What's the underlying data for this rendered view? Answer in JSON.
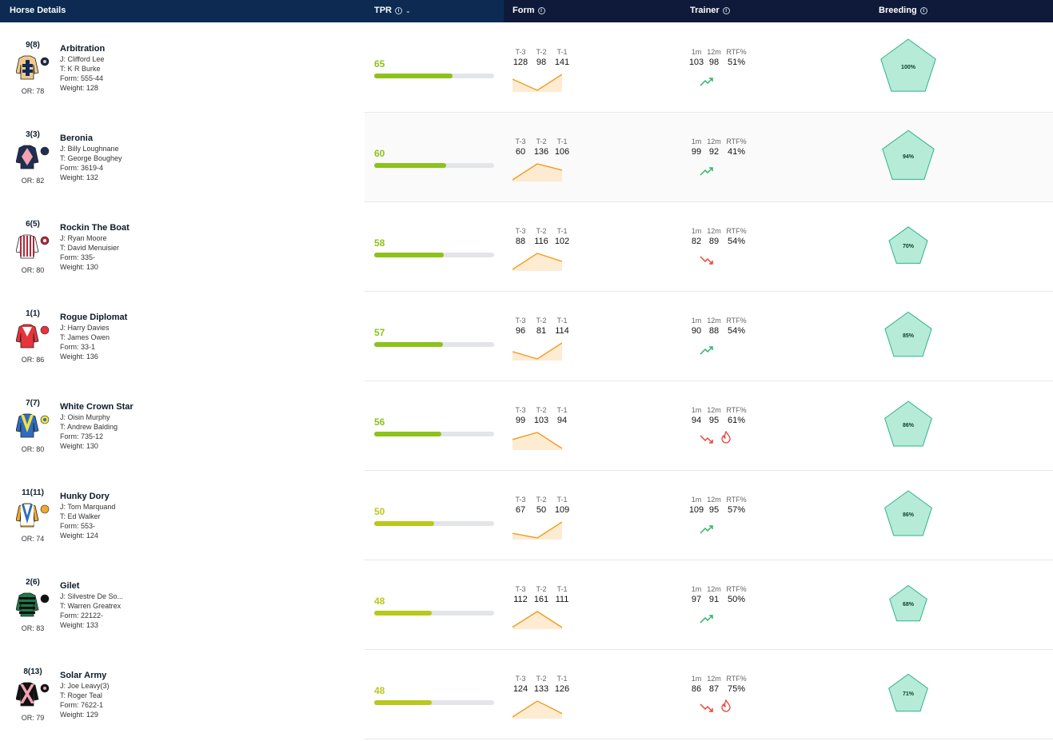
{
  "header": {
    "horse_details": "Horse Details",
    "tpr": "TPR",
    "form": "Form",
    "trainer": "Trainer",
    "breeding": "Breeding",
    "info_icon": "info-icon",
    "sort_icon": "chevron-down-icon"
  },
  "labels": {
    "form_cols": [
      "T-3",
      "T-2",
      "T-1"
    ],
    "trainer_cols": [
      "1m",
      "12m",
      "RTF%"
    ]
  },
  "colors": {
    "header_left": "#0c2a52",
    "header_right": "#0f1a3a",
    "tpr_high": "#8cc21a",
    "tpr_mid": "#b8c81c",
    "form_line": "#f39c1e",
    "trend_up": "#2fb36b",
    "trend_down": "#e8443a",
    "breeding_fill": "#b5ebd7",
    "breeding_stroke": "#2fb38a"
  },
  "horses": [
    {
      "position": "9(8)",
      "name": "Arbitration",
      "jockey": "J: Clifford Lee",
      "trainer": "T: K R Burke",
      "form": "Form: 555-44",
      "weight": "Weight: 128",
      "or": "OR: 78",
      "tpr": "65",
      "form_values": [
        "128",
        "98",
        "141"
      ],
      "trainer_stats": [
        "103",
        "98",
        "51%"
      ],
      "trend": "up",
      "hot": false,
      "breeding": "100%",
      "silk": {
        "body": "#f2c98a",
        "accent": "#102a5c",
        "pattern": "cross",
        "cap": "#102a5c",
        "cap_accent": "#f2c98a"
      }
    },
    {
      "position": "3(3)",
      "name": "Beronia",
      "jockey": "J: Billy Loughnane",
      "trainer": "T: George Boughey",
      "form": "Form: 3619-4",
      "weight": "Weight: 132",
      "or": "OR: 82",
      "tpr": "60",
      "form_values": [
        "60",
        "136",
        "106"
      ],
      "trainer_stats": [
        "99",
        "92",
        "41%"
      ],
      "trend": "up",
      "hot": false,
      "breeding": "94%",
      "silk": {
        "body": "#1e2f55",
        "accent": "#f2a2b0",
        "pattern": "diamond",
        "cap": "#1e2f55",
        "cap_accent": "#1e2f55"
      }
    },
    {
      "position": "6(5)",
      "name": "Rockin The Boat",
      "jockey": "J: Ryan Moore",
      "trainer": "T: David Menuisier",
      "form": "Form: 335-",
      "weight": "Weight: 130",
      "or": "OR: 80",
      "tpr": "58",
      "form_values": [
        "88",
        "116",
        "102"
      ],
      "trainer_stats": [
        "82",
        "89",
        "54%"
      ],
      "trend": "down",
      "hot": false,
      "breeding": "70%",
      "silk": {
        "body": "#ffffff",
        "accent": "#b02a3a",
        "pattern": "stripes",
        "cap": "#b02a3a",
        "cap_accent": "#ffffff"
      }
    },
    {
      "position": "1(1)",
      "name": "Rogue Diplomat",
      "jockey": "J: Harry Davies",
      "trainer": "T: James Owen",
      "form": "Form: 33-1",
      "weight": "Weight: 136",
      "or": "OR: 86",
      "tpr": "57",
      "form_values": [
        "96",
        "81",
        "114"
      ],
      "trainer_stats": [
        "90",
        "88",
        "54%"
      ],
      "trend": "up",
      "hot": false,
      "breeding": "85%",
      "silk": {
        "body": "#e8343a",
        "accent": "#ffffff",
        "pattern": "triangle",
        "cap": "#e8343a",
        "cap_accent": "#e8343a"
      }
    },
    {
      "position": "7(7)",
      "name": "White Crown Star",
      "jockey": "J: Oisin Murphy",
      "trainer": "T: Andrew Balding",
      "form": "Form: 735-12",
      "weight": "Weight: 130",
      "or": "OR: 80",
      "tpr": "56",
      "form_values": [
        "99",
        "103",
        "94"
      ],
      "trainer_stats": [
        "94",
        "95",
        "61%"
      ],
      "trend": "down",
      "hot": true,
      "breeding": "86%",
      "silk": {
        "body": "#2e6cc4",
        "accent": "#f2e23a",
        "pattern": "vee",
        "cap": "#f2e23a",
        "cap_accent": "#2e6cc4"
      }
    },
    {
      "position": "11(11)",
      "name": "Hunky Dory",
      "jockey": "J: Tom Marquand",
      "trainer": "T: Ed Walker",
      "form": "Form: 553-",
      "weight": "Weight: 124",
      "or": "OR: 74",
      "tpr": "50",
      "form_values": [
        "67",
        "50",
        "109"
      ],
      "trainer_stats": [
        "109",
        "95",
        "57%"
      ],
      "trend": "up",
      "hot": false,
      "breeding": "86%",
      "silk": {
        "body": "#f0a830",
        "accent": "#ffffff",
        "pattern": "vee-blue",
        "cap": "#f0a830",
        "cap_accent": "#f0a830"
      }
    },
    {
      "position": "2(6)",
      "name": "Gilet",
      "jockey": "J: Silvestre De So...",
      "trainer": "T: Warren Greatrex",
      "form": "Form: 22122-",
      "weight": "Weight: 133",
      "or": "OR: 83",
      "tpr": "48",
      "form_values": [
        "112",
        "161",
        "111"
      ],
      "trainer_stats": [
        "97",
        "91",
        "50%"
      ],
      "trend": "up",
      "hot": false,
      "breeding": "68%",
      "silk": {
        "body": "#1e7a4a",
        "accent": "#111111",
        "pattern": "hoops",
        "cap": "#111111",
        "cap_accent": "#111111"
      }
    },
    {
      "position": "8(13)",
      "name": "Solar Army",
      "jockey": "J: Joe Leavy(3)",
      "trainer": "T: Roger Teal",
      "form": "Form: 7622-1",
      "weight": "Weight: 129",
      "or": "OR: 79",
      "tpr": "48",
      "form_values": [
        "124",
        "133",
        "126"
      ],
      "trainer_stats": [
        "86",
        "87",
        "75%"
      ],
      "trend": "down",
      "hot": true,
      "breeding": "71%",
      "silk": {
        "body": "#111111",
        "accent": "#f2a2b0",
        "pattern": "xcross",
        "cap": "#111111",
        "cap_accent": "#f2a2b0"
      }
    }
  ]
}
